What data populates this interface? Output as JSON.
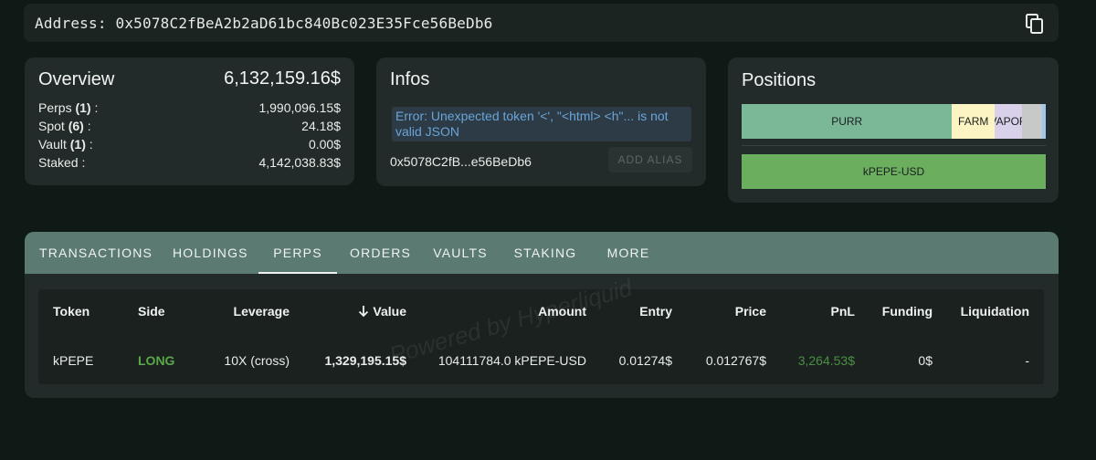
{
  "address_bar": {
    "label": "Address:",
    "value": "0x5078C2fBeA2b2aD61bc840Bc023E35Fce56BeDb6",
    "copy_icon": "copy-icon"
  },
  "overview": {
    "title": "Overview",
    "total": "6,132,159.16$",
    "rows": [
      {
        "label": "Perps",
        "count": "(1)",
        "suffix": " :",
        "value": "1,990,096.15$"
      },
      {
        "label": "Spot",
        "count": "(6)",
        "suffix": " :",
        "value": "24.18$"
      },
      {
        "label": "Vault",
        "count": "(1)",
        "suffix": " :",
        "value": "0.00$"
      },
      {
        "label": "Staked",
        "count": "",
        "suffix": " :",
        "value": "4,142,038.83$"
      }
    ]
  },
  "infos": {
    "title": "Infos",
    "error": "Error: Unexpected token '<', \"<html> <h\"... is not valid JSON",
    "short_address": "0x5078C2fB...e56BeDb6",
    "add_alias": "ADD ALIAS"
  },
  "positions": {
    "title": "Positions",
    "segments": [
      {
        "label": "PURR",
        "share": 0.692,
        "color": "#7bb898"
      },
      {
        "label": "FARM",
        "share": 0.14,
        "color": "#fcf5c3"
      },
      {
        "label": "VAPOR",
        "share": 0.09,
        "color": "#d9d0ea"
      },
      {
        "label": "",
        "share": 0.066,
        "color": "#c7c9c8"
      },
      {
        "label": "",
        "share": 0.012,
        "color": "#9dc8ee"
      }
    ],
    "perp_label": "kPEPE-USD"
  },
  "tabs": {
    "items": [
      "TRANSACTIONS",
      "HOLDINGS",
      "PERPS",
      "ORDERS",
      "VAULTS",
      "STAKING",
      "MORE"
    ],
    "active": "PERPS"
  },
  "table": {
    "watermark": "Powered by Hyperliquid",
    "headers": {
      "token": "Token",
      "side": "Side",
      "leverage": "Leverage",
      "value": "Value",
      "amount": "Amount",
      "entry": "Entry",
      "price": "Price",
      "pnl": "PnL",
      "funding": "Funding",
      "liquidation": "Liquidation"
    },
    "rows": [
      {
        "token": "kPEPE",
        "side": "LONG",
        "leverage": "10X (cross)",
        "value": "1,329,195.15$",
        "amount": "104111784.0 kPEPE-USD",
        "entry": "0.01274$",
        "price": "0.012767$",
        "pnl": "3,264.53$",
        "funding": "0$",
        "liquidation": "-"
      }
    ],
    "colors": {
      "long": "#5aa84a",
      "pnl_positive": "#4c8f43"
    }
  }
}
